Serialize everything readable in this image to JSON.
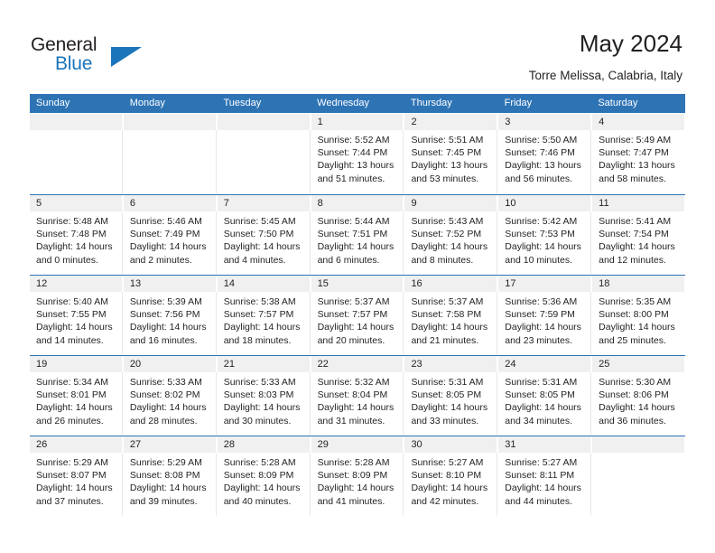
{
  "logo": {
    "word_one": "General",
    "word_two": "Blue",
    "triangle": "blue-triangle-icon",
    "brand_color": "#1b75bb"
  },
  "header": {
    "title": "May 2024",
    "subtitle": "Torre Melissa, Calabria, Italy"
  },
  "theme": {
    "header_bg": "#2e74b5",
    "daynum_bg": "#f0f0f0",
    "text": "#231f20"
  },
  "weekdays": [
    "Sunday",
    "Monday",
    "Tuesday",
    "Wednesday",
    "Thursday",
    "Friday",
    "Saturday"
  ],
  "weeks": [
    [
      {
        "day": "",
        "empty": true
      },
      {
        "day": "",
        "empty": true
      },
      {
        "day": "",
        "empty": true
      },
      {
        "day": "1",
        "sunrise": "Sunrise: 5:52 AM",
        "sunset": "Sunset: 7:44 PM",
        "daylight1": "Daylight: 13 hours",
        "daylight2": "and 51 minutes."
      },
      {
        "day": "2",
        "sunrise": "Sunrise: 5:51 AM",
        "sunset": "Sunset: 7:45 PM",
        "daylight1": "Daylight: 13 hours",
        "daylight2": "and 53 minutes."
      },
      {
        "day": "3",
        "sunrise": "Sunrise: 5:50 AM",
        "sunset": "Sunset: 7:46 PM",
        "daylight1": "Daylight: 13 hours",
        "daylight2": "and 56 minutes."
      },
      {
        "day": "4",
        "sunrise": "Sunrise: 5:49 AM",
        "sunset": "Sunset: 7:47 PM",
        "daylight1": "Daylight: 13 hours",
        "daylight2": "and 58 minutes."
      }
    ],
    [
      {
        "day": "5",
        "sunrise": "Sunrise: 5:48 AM",
        "sunset": "Sunset: 7:48 PM",
        "daylight1": "Daylight: 14 hours",
        "daylight2": "and 0 minutes."
      },
      {
        "day": "6",
        "sunrise": "Sunrise: 5:46 AM",
        "sunset": "Sunset: 7:49 PM",
        "daylight1": "Daylight: 14 hours",
        "daylight2": "and 2 minutes."
      },
      {
        "day": "7",
        "sunrise": "Sunrise: 5:45 AM",
        "sunset": "Sunset: 7:50 PM",
        "daylight1": "Daylight: 14 hours",
        "daylight2": "and 4 minutes."
      },
      {
        "day": "8",
        "sunrise": "Sunrise: 5:44 AM",
        "sunset": "Sunset: 7:51 PM",
        "daylight1": "Daylight: 14 hours",
        "daylight2": "and 6 minutes."
      },
      {
        "day": "9",
        "sunrise": "Sunrise: 5:43 AM",
        "sunset": "Sunset: 7:52 PM",
        "daylight1": "Daylight: 14 hours",
        "daylight2": "and 8 minutes."
      },
      {
        "day": "10",
        "sunrise": "Sunrise: 5:42 AM",
        "sunset": "Sunset: 7:53 PM",
        "daylight1": "Daylight: 14 hours",
        "daylight2": "and 10 minutes."
      },
      {
        "day": "11",
        "sunrise": "Sunrise: 5:41 AM",
        "sunset": "Sunset: 7:54 PM",
        "daylight1": "Daylight: 14 hours",
        "daylight2": "and 12 minutes."
      }
    ],
    [
      {
        "day": "12",
        "sunrise": "Sunrise: 5:40 AM",
        "sunset": "Sunset: 7:55 PM",
        "daylight1": "Daylight: 14 hours",
        "daylight2": "and 14 minutes."
      },
      {
        "day": "13",
        "sunrise": "Sunrise: 5:39 AM",
        "sunset": "Sunset: 7:56 PM",
        "daylight1": "Daylight: 14 hours",
        "daylight2": "and 16 minutes."
      },
      {
        "day": "14",
        "sunrise": "Sunrise: 5:38 AM",
        "sunset": "Sunset: 7:57 PM",
        "daylight1": "Daylight: 14 hours",
        "daylight2": "and 18 minutes."
      },
      {
        "day": "15",
        "sunrise": "Sunrise: 5:37 AM",
        "sunset": "Sunset: 7:57 PM",
        "daylight1": "Daylight: 14 hours",
        "daylight2": "and 20 minutes."
      },
      {
        "day": "16",
        "sunrise": "Sunrise: 5:37 AM",
        "sunset": "Sunset: 7:58 PM",
        "daylight1": "Daylight: 14 hours",
        "daylight2": "and 21 minutes."
      },
      {
        "day": "17",
        "sunrise": "Sunrise: 5:36 AM",
        "sunset": "Sunset: 7:59 PM",
        "daylight1": "Daylight: 14 hours",
        "daylight2": "and 23 minutes."
      },
      {
        "day": "18",
        "sunrise": "Sunrise: 5:35 AM",
        "sunset": "Sunset: 8:00 PM",
        "daylight1": "Daylight: 14 hours",
        "daylight2": "and 25 minutes."
      }
    ],
    [
      {
        "day": "19",
        "sunrise": "Sunrise: 5:34 AM",
        "sunset": "Sunset: 8:01 PM",
        "daylight1": "Daylight: 14 hours",
        "daylight2": "and 26 minutes."
      },
      {
        "day": "20",
        "sunrise": "Sunrise: 5:33 AM",
        "sunset": "Sunset: 8:02 PM",
        "daylight1": "Daylight: 14 hours",
        "daylight2": "and 28 minutes."
      },
      {
        "day": "21",
        "sunrise": "Sunrise: 5:33 AM",
        "sunset": "Sunset: 8:03 PM",
        "daylight1": "Daylight: 14 hours",
        "daylight2": "and 30 minutes."
      },
      {
        "day": "22",
        "sunrise": "Sunrise: 5:32 AM",
        "sunset": "Sunset: 8:04 PM",
        "daylight1": "Daylight: 14 hours",
        "daylight2": "and 31 minutes."
      },
      {
        "day": "23",
        "sunrise": "Sunrise: 5:31 AM",
        "sunset": "Sunset: 8:05 PM",
        "daylight1": "Daylight: 14 hours",
        "daylight2": "and 33 minutes."
      },
      {
        "day": "24",
        "sunrise": "Sunrise: 5:31 AM",
        "sunset": "Sunset: 8:05 PM",
        "daylight1": "Daylight: 14 hours",
        "daylight2": "and 34 minutes."
      },
      {
        "day": "25",
        "sunrise": "Sunrise: 5:30 AM",
        "sunset": "Sunset: 8:06 PM",
        "daylight1": "Daylight: 14 hours",
        "daylight2": "and 36 minutes."
      }
    ],
    [
      {
        "day": "26",
        "sunrise": "Sunrise: 5:29 AM",
        "sunset": "Sunset: 8:07 PM",
        "daylight1": "Daylight: 14 hours",
        "daylight2": "and 37 minutes."
      },
      {
        "day": "27",
        "sunrise": "Sunrise: 5:29 AM",
        "sunset": "Sunset: 8:08 PM",
        "daylight1": "Daylight: 14 hours",
        "daylight2": "and 39 minutes."
      },
      {
        "day": "28",
        "sunrise": "Sunrise: 5:28 AM",
        "sunset": "Sunset: 8:09 PM",
        "daylight1": "Daylight: 14 hours",
        "daylight2": "and 40 minutes."
      },
      {
        "day": "29",
        "sunrise": "Sunrise: 5:28 AM",
        "sunset": "Sunset: 8:09 PM",
        "daylight1": "Daylight: 14 hours",
        "daylight2": "and 41 minutes."
      },
      {
        "day": "30",
        "sunrise": "Sunrise: 5:27 AM",
        "sunset": "Sunset: 8:10 PM",
        "daylight1": "Daylight: 14 hours",
        "daylight2": "and 42 minutes."
      },
      {
        "day": "31",
        "sunrise": "Sunrise: 5:27 AM",
        "sunset": "Sunset: 8:11 PM",
        "daylight1": "Daylight: 14 hours",
        "daylight2": "and 44 minutes."
      },
      {
        "day": "",
        "empty": true
      }
    ]
  ]
}
